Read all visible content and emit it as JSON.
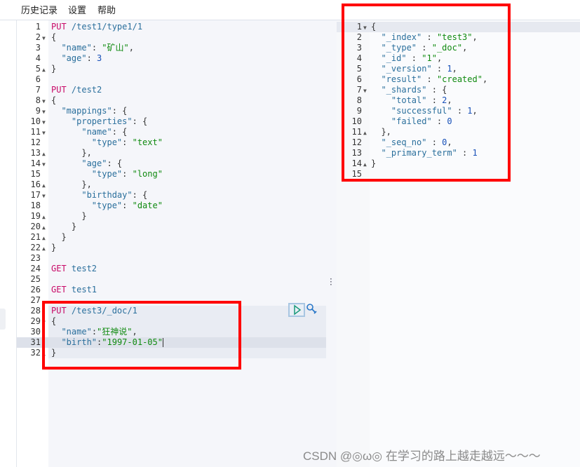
{
  "menu": {
    "items": [
      "历史记录",
      "设置",
      "帮助"
    ]
  },
  "colors": {
    "highlight_box": "#ff0000",
    "keyword": "#c80a68",
    "string": "#108a10",
    "key": "#2a6f9c"
  },
  "request_editor": {
    "active_line": 31,
    "request_block_lines": [
      28,
      32
    ],
    "lines": [
      [
        [
          "kw",
          "PUT"
        ],
        [
          "url",
          " /test1/type1/1"
        ]
      ],
      [
        [
          "p",
          "{"
        ]
      ],
      [
        [
          "p",
          "  "
        ],
        [
          "key",
          "\"name\""
        ],
        [
          "p",
          ": "
        ],
        [
          "str",
          "\"矿山\""
        ],
        [
          "p",
          ","
        ]
      ],
      [
        [
          "p",
          "  "
        ],
        [
          "key",
          "\"age\""
        ],
        [
          "p",
          ": "
        ],
        [
          "num",
          "3"
        ]
      ],
      [
        [
          "p",
          "}"
        ]
      ],
      [],
      [
        [
          "kw",
          "PUT"
        ],
        [
          "url",
          " /test2"
        ]
      ],
      [
        [
          "p",
          "{"
        ]
      ],
      [
        [
          "p",
          "  "
        ],
        [
          "key",
          "\"mappings\""
        ],
        [
          "p",
          ": {"
        ]
      ],
      [
        [
          "p",
          "    "
        ],
        [
          "key",
          "\"properties\""
        ],
        [
          "p",
          ": {"
        ]
      ],
      [
        [
          "p",
          "      "
        ],
        [
          "key",
          "\"name\""
        ],
        [
          "p",
          ": {"
        ]
      ],
      [
        [
          "p",
          "        "
        ],
        [
          "key",
          "\"type\""
        ],
        [
          "p",
          ": "
        ],
        [
          "str",
          "\"text\""
        ]
      ],
      [
        [
          "p",
          "      },"
        ]
      ],
      [
        [
          "p",
          "      "
        ],
        [
          "key",
          "\"age\""
        ],
        [
          "p",
          ": {"
        ]
      ],
      [
        [
          "p",
          "        "
        ],
        [
          "key",
          "\"type\""
        ],
        [
          "p",
          ": "
        ],
        [
          "str",
          "\"long\""
        ]
      ],
      [
        [
          "p",
          "      },"
        ]
      ],
      [
        [
          "p",
          "      "
        ],
        [
          "key",
          "\"birthday\""
        ],
        [
          "p",
          ": {"
        ]
      ],
      [
        [
          "p",
          "        "
        ],
        [
          "key",
          "\"type\""
        ],
        [
          "p",
          ": "
        ],
        [
          "str",
          "\"date\""
        ]
      ],
      [
        [
          "p",
          "      }"
        ]
      ],
      [
        [
          "p",
          "    }"
        ]
      ],
      [
        [
          "p",
          "  }"
        ]
      ],
      [
        [
          "p",
          "}"
        ]
      ],
      [],
      [
        [
          "kw",
          "GET"
        ],
        [
          "url",
          " test2"
        ]
      ],
      [],
      [
        [
          "kw",
          "GET"
        ],
        [
          "url",
          " test1"
        ]
      ],
      [],
      [
        [
          "kw",
          "PUT"
        ],
        [
          "url",
          " /test3/_doc/1"
        ]
      ],
      [
        [
          "p",
          "{"
        ]
      ],
      [
        [
          "p",
          "  "
        ],
        [
          "key",
          "\"name\""
        ],
        [
          "p",
          ":"
        ],
        [
          "str",
          "\"狂神说\""
        ],
        [
          "p",
          ","
        ]
      ],
      [
        [
          "p",
          "  "
        ],
        [
          "key",
          "\"birth\""
        ],
        [
          "p",
          ":"
        ],
        [
          "str",
          "\"1997-01-05\""
        ]
      ],
      [
        [
          "p",
          "}"
        ]
      ]
    ],
    "folds": {
      "2": "open",
      "5": "close",
      "8": "open",
      "9": "open",
      "10": "open",
      "11": "open",
      "13": "close",
      "14": "open",
      "16": "close",
      "17": "open",
      "19": "close",
      "20": "close",
      "21": "close",
      "22": "close",
      "29": "open",
      "32": "close"
    }
  },
  "response_editor": {
    "active_line": 1,
    "lines": [
      [
        [
          "p",
          "{"
        ]
      ],
      [
        [
          "p",
          "  "
        ],
        [
          "key",
          "\"_index\""
        ],
        [
          "p",
          " : "
        ],
        [
          "str",
          "\"test3\""
        ],
        [
          "p",
          ","
        ]
      ],
      [
        [
          "p",
          "  "
        ],
        [
          "key",
          "\"_type\""
        ],
        [
          "p",
          " : "
        ],
        [
          "str",
          "\"_doc\""
        ],
        [
          "p",
          ","
        ]
      ],
      [
        [
          "p",
          "  "
        ],
        [
          "key",
          "\"_id\""
        ],
        [
          "p",
          " : "
        ],
        [
          "str",
          "\"1\""
        ],
        [
          "p",
          ","
        ]
      ],
      [
        [
          "p",
          "  "
        ],
        [
          "key",
          "\"_version\""
        ],
        [
          "p",
          " : "
        ],
        [
          "num",
          "1"
        ],
        [
          "p",
          ","
        ]
      ],
      [
        [
          "p",
          "  "
        ],
        [
          "key",
          "\"result\""
        ],
        [
          "p",
          " : "
        ],
        [
          "str",
          "\"created\""
        ],
        [
          "p",
          ","
        ]
      ],
      [
        [
          "p",
          "  "
        ],
        [
          "key",
          "\"_shards\""
        ],
        [
          "p",
          " : {"
        ]
      ],
      [
        [
          "p",
          "    "
        ],
        [
          "key",
          "\"total\""
        ],
        [
          "p",
          " : "
        ],
        [
          "num",
          "2"
        ],
        [
          "p",
          ","
        ]
      ],
      [
        [
          "p",
          "    "
        ],
        [
          "key",
          "\"successful\""
        ],
        [
          "p",
          " : "
        ],
        [
          "num",
          "1"
        ],
        [
          "p",
          ","
        ]
      ],
      [
        [
          "p",
          "    "
        ],
        [
          "key",
          "\"failed\""
        ],
        [
          "p",
          " : "
        ],
        [
          "num",
          "0"
        ]
      ],
      [
        [
          "p",
          "  },"
        ]
      ],
      [
        [
          "p",
          "  "
        ],
        [
          "key",
          "\"_seq_no\""
        ],
        [
          "p",
          " : "
        ],
        [
          "num",
          "0"
        ],
        [
          "p",
          ","
        ]
      ],
      [
        [
          "p",
          "  "
        ],
        [
          "key",
          "\"_primary_term\""
        ],
        [
          "p",
          " : "
        ],
        [
          "num",
          "1"
        ]
      ],
      [
        [
          "p",
          "}"
        ]
      ],
      []
    ],
    "folds": {
      "1": "open",
      "7": "open",
      "11": "close",
      "14": "close"
    }
  },
  "icons": {
    "run": "play-icon",
    "settings": "wrench-icon",
    "resize": "vertical-dots-icon"
  },
  "watermark": "CSDN @◎ω◎ 在学习的路上越走越远～～～"
}
